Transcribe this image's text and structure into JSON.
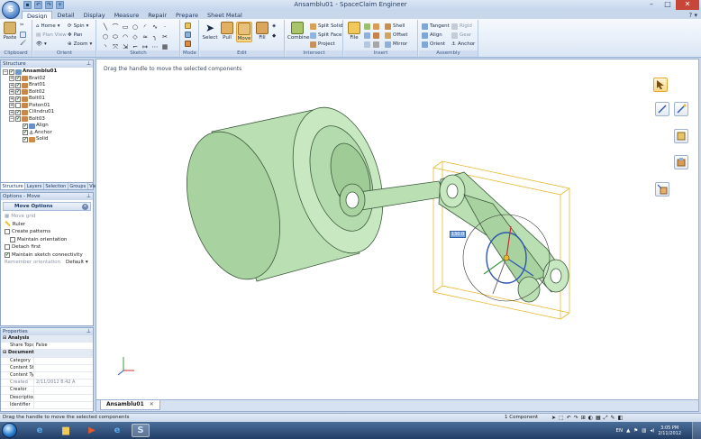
{
  "window": {
    "title": "Ansamblu01 - SpaceClaim Engineer",
    "colors": {
      "title_bg": "#c4d5ec",
      "close": "#c8453a",
      "accent": "#f9d98c",
      "model": "#b9dfb2"
    }
  },
  "quick_access": [
    "save",
    "undo",
    "redo",
    "new"
  ],
  "menu_tabs": [
    "Design",
    "Detail",
    "Display",
    "Measure",
    "Repair",
    "Prepare",
    "Sheet Metal"
  ],
  "active_tab": "Design",
  "ribbon": {
    "clipboard": {
      "label": "Clipboard",
      "paste": "Paste"
    },
    "orient": {
      "label": "Orient",
      "home": "Home",
      "plan_view": "Plan View",
      "spin": "Spin",
      "pan": "Pan",
      "zoom": "Zoom"
    },
    "sketch": {
      "label": "Sketch"
    },
    "mode": {
      "label": "Mode"
    },
    "edit": {
      "label": "Edit",
      "select": "Select",
      "pull": "Pull",
      "move": "Move",
      "fill": "Fill"
    },
    "intersect": {
      "label": "Intersect",
      "combine": "Combine",
      "split_solid": "Split Solid",
      "split_face": "Split Face",
      "project": "Project"
    },
    "insert": {
      "label": "Insert",
      "file": "File",
      "shell": "Shell",
      "offset": "Offset",
      "mirror": "Mirror"
    },
    "assembly": {
      "label": "Assembly",
      "tangent": "Tangent",
      "align": "Align",
      "orient": "Orient",
      "rigid": "Rigid",
      "gear": "Gear",
      "anchor": "Anchor"
    }
  },
  "structure": {
    "title": "Structure",
    "root": "Ansamblu01",
    "items": [
      {
        "label": "Brat02",
        "checked": "✔",
        "expander": "+"
      },
      {
        "label": "Brat01",
        "checked": "✔",
        "expander": "+"
      },
      {
        "label": "Bolt02",
        "checked": "✔",
        "expander": "+"
      },
      {
        "label": "Bolt01",
        "checked": "✔",
        "expander": "+"
      },
      {
        "label": "Piston01",
        "checked": "",
        "expander": "+"
      },
      {
        "label": "Cilindru01",
        "checked": "✔",
        "expander": "+"
      },
      {
        "label": "Bolt03",
        "checked": "✔",
        "expander": "−"
      }
    ],
    "sub_items": [
      "Align",
      "Anchor",
      "Solid"
    ],
    "panel_tabs": [
      "Structure",
      "Layers",
      "Selection",
      "Groups",
      "Views"
    ]
  },
  "options": {
    "title": "Options - Move",
    "header": "Move Options",
    "move_grid": "Move grid",
    "ruler": "Ruler",
    "create_patterns": "Create patterns",
    "maintain_orientation": "Maintain orientation",
    "detach_first": "Detach first",
    "maintain_sketch": "Maintain sketch connectivity",
    "remember_orientation": "Remember orientation",
    "orientation_value": "Default"
  },
  "properties": {
    "title": "Properties",
    "rows": [
      {
        "key": "Analysis",
        "value": "",
        "section": true
      },
      {
        "key": "Share Topolo",
        "value": "False"
      },
      {
        "key": "Document",
        "value": "",
        "section": true
      },
      {
        "key": "Category",
        "value": ""
      },
      {
        "key": "Content Stat",
        "value": ""
      },
      {
        "key": "Content Typ",
        "value": ""
      },
      {
        "key": "Created",
        "value": "2/11/2012 8:42 A",
        "dim": true
      },
      {
        "key": "Creator",
        "value": ""
      },
      {
        "key": "Description",
        "value": ""
      },
      {
        "key": "Identifier",
        "value": ""
      }
    ]
  },
  "viewport": {
    "hint": "Drag the handle to move the selected components",
    "dimension": "130.0"
  },
  "document_tab": "Ansamblu01",
  "status": {
    "message": "Drag the handle to move the selected components",
    "selection": "1 Component"
  },
  "taskbar": {
    "language": "EN",
    "time": "3:05 PM",
    "date": "2/11/2012"
  }
}
